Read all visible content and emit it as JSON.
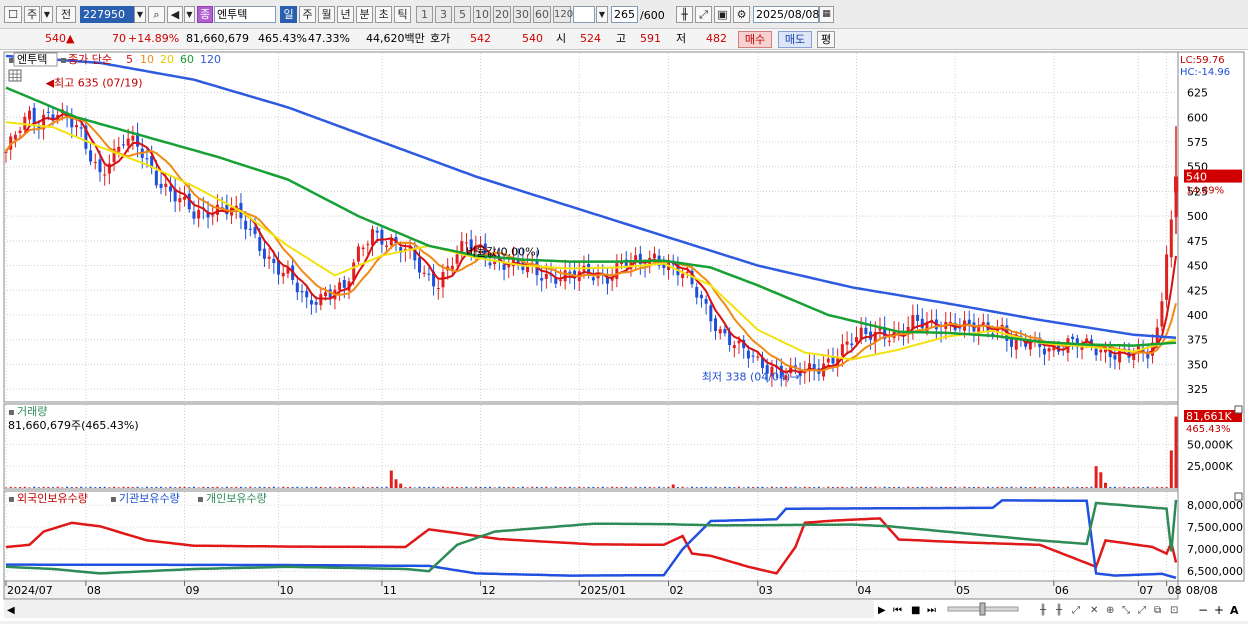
{
  "toolbar": {
    "mode_items": [
      "주",
      "전"
    ],
    "stock_code": "227950",
    "stock_name_badge": "종",
    "stock_name": "엔투텍",
    "period_tabs": [
      "일",
      "주",
      "월",
      "년",
      "분",
      "초",
      "틱"
    ],
    "selected_period": "일",
    "interval_buttons": [
      "1",
      "3",
      "5",
      "10",
      "20",
      "30",
      "60",
      "120"
    ],
    "count": "265",
    "count_total": "/600",
    "date": "2025/08/08"
  },
  "quote": {
    "price": "540",
    "change": "70",
    "change_pct": "+14.89%",
    "volume": "81,660,679",
    "volume_ratio": "465.43%",
    "turnover": "47.33%",
    "amount": "44,620백만",
    "hoga_label": "호가",
    "hoga_sell": "542",
    "hoga_buy": "540",
    "open_label": "시",
    "open": "524",
    "high_label": "고",
    "high": "591",
    "low_label": "저",
    "low": "482",
    "buy_label": "매수",
    "sell_label": "매도",
    "avg_label": "평"
  },
  "price_panel": {
    "legend_name": "엔투텍",
    "legend_ma": "종가 단순",
    "lc_label": "LC:59.76",
    "hc_label": "HC:-14.96",
    "max_label": "최고 635 (07/19)",
    "min_label": "최저 338 (04/04)",
    "ratio_label": "비율값(0.00%)",
    "current_price_tag": "540",
    "current_pct_tag": "14.89%"
  },
  "volume_panel": {
    "title": "거래량",
    "value_text": "81,660,679주(465.43%)",
    "tag_value": "81,661K",
    "tag_pct": "465.43%"
  },
  "holding_panel": {
    "legend": [
      "외국인보유수량",
      "기관보유수량",
      "개인보유수량"
    ]
  },
  "colors": {
    "candle_up": "#e02020",
    "candle_down": "#1d4fd8",
    "ma5": "#d81010",
    "ma10": "#f08a14",
    "ma20": "#f2e20f",
    "ma60": "#17a033",
    "ma120": "#2e5ae0",
    "foreign": "#e01818",
    "institution": "#2050e0",
    "individual": "#2e8b57"
  },
  "chart_data": [
    {
      "type": "candlestick",
      "title": "엔투텍",
      "ylim": [
        313,
        665
      ],
      "y_ticks": [
        325,
        350,
        375,
        400,
        425,
        450,
        475,
        500,
        525,
        550,
        575,
        600,
        625
      ],
      "x_tick_labels": [
        "2024/07",
        "08",
        "09",
        "10",
        "11",
        "12",
        "2025/01",
        "02",
        "03",
        "04",
        "05",
        "06",
        "07",
        "08",
        "08/08"
      ],
      "series": [
        {
          "name": "5",
          "color": "#d81010"
        },
        {
          "name": "10",
          "color": "#f08a14"
        },
        {
          "name": "20",
          "color": "#f2e20f"
        },
        {
          "name": "60",
          "color": "#17a033"
        },
        {
          "name": "120",
          "color": "#2e5ae0"
        }
      ],
      "close_path": [
        [
          0,
          565
        ],
        [
          3,
          588
        ],
        [
          5,
          600
        ],
        [
          7,
          595
        ],
        [
          9,
          607
        ],
        [
          11,
          605
        ],
        [
          13,
          598
        ],
        [
          16,
          580
        ],
        [
          18,
          560
        ],
        [
          20,
          545
        ],
        [
          22,
          558
        ],
        [
          25,
          575
        ],
        [
          28,
          570
        ],
        [
          32,
          540
        ],
        [
          36,
          520
        ],
        [
          40,
          500
        ],
        [
          45,
          510
        ],
        [
          48,
          508
        ],
        [
          52,
          482
        ],
        [
          56,
          458
        ],
        [
          60,
          440
        ],
        [
          64,
          410
        ],
        [
          67,
          420
        ],
        [
          70,
          430
        ],
        [
          72,
          425
        ],
        [
          75,
          460
        ],
        [
          78,
          485
        ],
        [
          80,
          480
        ],
        [
          83,
          470
        ],
        [
          86,
          460
        ],
        [
          89,
          440
        ],
        [
          92,
          435
        ],
        [
          95,
          455
        ],
        [
          98,
          470
        ],
        [
          101,
          465
        ],
        [
          104,
          455
        ],
        [
          108,
          450
        ],
        [
          112,
          445
        ],
        [
          116,
          440
        ],
        [
          120,
          438
        ],
        [
          124,
          442
        ],
        [
          128,
          440
        ],
        [
          130,
          448
        ],
        [
          132,
          452
        ],
        [
          135,
          450
        ],
        [
          138,
          460
        ],
        [
          141,
          453
        ],
        [
          144,
          440
        ],
        [
          148,
          415
        ],
        [
          152,
          385
        ],
        [
          156,
          365
        ],
        [
          160,
          352
        ],
        [
          163,
          348
        ],
        [
          166,
          342
        ],
        [
          169,
          340
        ],
        [
          172,
          345
        ],
        [
          175,
          355
        ],
        [
          178,
          365
        ],
        [
          182,
          378
        ],
        [
          186,
          385
        ],
        [
          190,
          378
        ],
        [
          193,
          390
        ],
        [
          196,
          392
        ],
        [
          200,
          392
        ],
        [
          204,
          385
        ],
        [
          208,
          388
        ],
        [
          212,
          388
        ],
        [
          214,
          370
        ],
        [
          216,
          368
        ],
        [
          218,
          372
        ],
        [
          222,
          368
        ],
        [
          226,
          370
        ],
        [
          230,
          368
        ],
        [
          234,
          366
        ],
        [
          237,
          360
        ],
        [
          240,
          358
        ],
        [
          243,
          362
        ],
        [
          245,
          385
        ],
        [
          246,
          420
        ],
        [
          247,
          470
        ],
        [
          248,
          495
        ],
        [
          249,
          540
        ]
      ],
      "ma20_path": [
        [
          0,
          595
        ],
        [
          10,
          590
        ],
        [
          20,
          570
        ],
        [
          30,
          552
        ],
        [
          40,
          530
        ],
        [
          50,
          505
        ],
        [
          60,
          470
        ],
        [
          70,
          440
        ],
        [
          80,
          460
        ],
        [
          90,
          470
        ],
        [
          100,
          458
        ],
        [
          110,
          450
        ],
        [
          120,
          447
        ],
        [
          130,
          448
        ],
        [
          140,
          452
        ],
        [
          150,
          430
        ],
        [
          160,
          385
        ],
        [
          170,
          362
        ],
        [
          180,
          355
        ],
        [
          190,
          365
        ],
        [
          200,
          378
        ],
        [
          210,
          384
        ],
        [
          220,
          372
        ],
        [
          230,
          368
        ],
        [
          240,
          363
        ],
        [
          249,
          375
        ]
      ],
      "ma60_path": [
        [
          0,
          630
        ],
        [
          15,
          600
        ],
        [
          30,
          580
        ],
        [
          45,
          560
        ],
        [
          60,
          537
        ],
        [
          75,
          500
        ],
        [
          90,
          470
        ],
        [
          100,
          460
        ],
        [
          110,
          456
        ],
        [
          120,
          454
        ],
        [
          130,
          454
        ],
        [
          140,
          455
        ],
        [
          150,
          448
        ],
        [
          160,
          430
        ],
        [
          175,
          400
        ],
        [
          190,
          383
        ],
        [
          200,
          382
        ],
        [
          210,
          379
        ],
        [
          220,
          373
        ],
        [
          230,
          370
        ],
        [
          240,
          369
        ],
        [
          249,
          372
        ]
      ],
      "ma120_path": [
        [
          0,
          662
        ],
        [
          20,
          655
        ],
        [
          40,
          638
        ],
        [
          60,
          610
        ],
        [
          80,
          575
        ],
        [
          100,
          540
        ],
        [
          120,
          510
        ],
        [
          140,
          480
        ],
        [
          160,
          450
        ],
        [
          180,
          428
        ],
        [
          200,
          412
        ],
        [
          220,
          395
        ],
        [
          240,
          380
        ],
        [
          249,
          377
        ]
      ],
      "annotations": [
        {
          "text": "최고 635 (07/19)",
          "x": 8,
          "y": 635
        },
        {
          "text": "최저 338 (04/04)",
          "x": 170,
          "y": 338
        }
      ]
    },
    {
      "type": "bar",
      "title": "거래량",
      "ylim": [
        0,
        95000
      ],
      "y_ticks": [
        25000,
        50000
      ],
      "y_tick_labels": [
        "25,000K",
        "50,000K"
      ],
      "spikes": [
        {
          "x": 82,
          "value": 20000
        },
        {
          "x": 83,
          "value": 10000
        },
        {
          "x": 84,
          "value": 5000
        },
        {
          "x": 142,
          "value": 4000
        },
        {
          "x": 232,
          "value": 25000
        },
        {
          "x": 233,
          "value": 18000
        },
        {
          "x": 234,
          "value": 6000
        },
        {
          "x": 248,
          "value": 43000
        },
        {
          "x": 249,
          "value": 81661
        }
      ]
    },
    {
      "type": "line",
      "title": "외국인보유수량 / 기관보유수량 / 개인보유수량",
      "ylim": [
        6300000,
        8300000
      ],
      "y_ticks": [
        6500000,
        7000000,
        7500000,
        8000000
      ],
      "y_tick_labels": [
        "6,500,000",
        "7,000,000",
        "7,500,000",
        "8,000,000"
      ],
      "series": [
        {
          "name": "외국인보유수량",
          "color": "#e01818",
          "points": [
            [
              0,
              7050000
            ],
            [
              5,
              7100000
            ],
            [
              8,
              7400000
            ],
            [
              14,
              7600000
            ],
            [
              20,
              7520000
            ],
            [
              30,
              7200000
            ],
            [
              40,
              7080000
            ],
            [
              60,
              7060000
            ],
            [
              85,
              7050000
            ],
            [
              90,
              7450000
            ],
            [
              95,
              7380000
            ],
            [
              105,
              7230000
            ],
            [
              125,
              7110000
            ],
            [
              140,
              7100000
            ],
            [
              144,
              7300000
            ],
            [
              146,
              6900000
            ],
            [
              150,
              6850000
            ],
            [
              158,
              6600000
            ],
            [
              164,
              6450000
            ],
            [
              168,
              7050000
            ],
            [
              170,
              7600000
            ],
            [
              176,
              7650000
            ],
            [
              186,
              7700000
            ],
            [
              190,
              7220000
            ],
            [
              205,
              7150000
            ],
            [
              220,
              7100000
            ],
            [
              226,
              6850000
            ],
            [
              232,
              6600000
            ],
            [
              234,
              7200000
            ],
            [
              244,
              7050000
            ],
            [
              247,
              6900000
            ],
            [
              248,
              7150000
            ],
            [
              249,
              6700000
            ]
          ]
        },
        {
          "name": "기관보유수량",
          "color": "#2050e0",
          "points": [
            [
              0,
              6650000
            ],
            [
              60,
              6640000
            ],
            [
              90,
              6620000
            ],
            [
              100,
              6450000
            ],
            [
              120,
              6400000
            ],
            [
              140,
              6410000
            ],
            [
              144,
              7000000
            ],
            [
              150,
              7640000
            ],
            [
              164,
              7680000
            ],
            [
              166,
              7920000
            ],
            [
              210,
              7940000
            ],
            [
              212,
              8110000
            ],
            [
              230,
              8100000
            ],
            [
              232,
              6450000
            ],
            [
              236,
              6400000
            ],
            [
              246,
              6440000
            ],
            [
              249,
              6350000
            ]
          ]
        },
        {
          "name": "개인보유수량",
          "color": "#2e8b57",
          "points": [
            [
              0,
              6600000
            ],
            [
              10,
              6550000
            ],
            [
              20,
              6450000
            ],
            [
              40,
              6550000
            ],
            [
              60,
              6600000
            ],
            [
              85,
              6550000
            ],
            [
              90,
              6500000
            ],
            [
              96,
              7100000
            ],
            [
              104,
              7400000
            ],
            [
              125,
              7580000
            ],
            [
              140,
              7570000
            ],
            [
              152,
              7540000
            ],
            [
              180,
              7560000
            ],
            [
              188,
              7520000
            ],
            [
              200,
              7400000
            ],
            [
              220,
              7200000
            ],
            [
              230,
              7120000
            ],
            [
              232,
              8050000
            ],
            [
              240,
              7980000
            ],
            [
              247,
              7920000
            ],
            [
              248,
              6950000
            ],
            [
              249,
              8120000
            ]
          ]
        }
      ]
    }
  ]
}
